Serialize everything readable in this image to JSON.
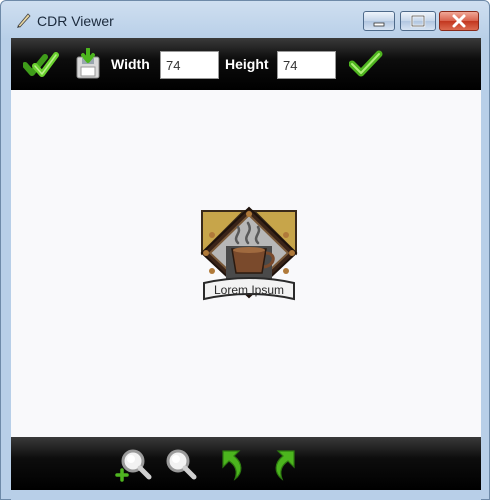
{
  "window": {
    "title": "CDR Viewer"
  },
  "toolbar": {
    "width_label": "Width",
    "width_value": "74",
    "height_label": "Height",
    "height_value": "74"
  },
  "artwork": {
    "banner_text": "Lorem Ipsum"
  },
  "icons": {
    "app": "pencil-icon",
    "select_all": "double-check-icon",
    "save": "save-disk-icon",
    "apply": "check-icon",
    "zoom_in": "zoom-in-icon",
    "zoom_out": "zoom-out-icon",
    "rotate_left": "rotate-left-icon",
    "rotate_right": "rotate-right-icon"
  },
  "colors": {
    "toolbar_bg": "#000000",
    "accent_green": "#5cc02a",
    "title_bar": "#b8cfe8",
    "close_red": "#c2361f"
  }
}
